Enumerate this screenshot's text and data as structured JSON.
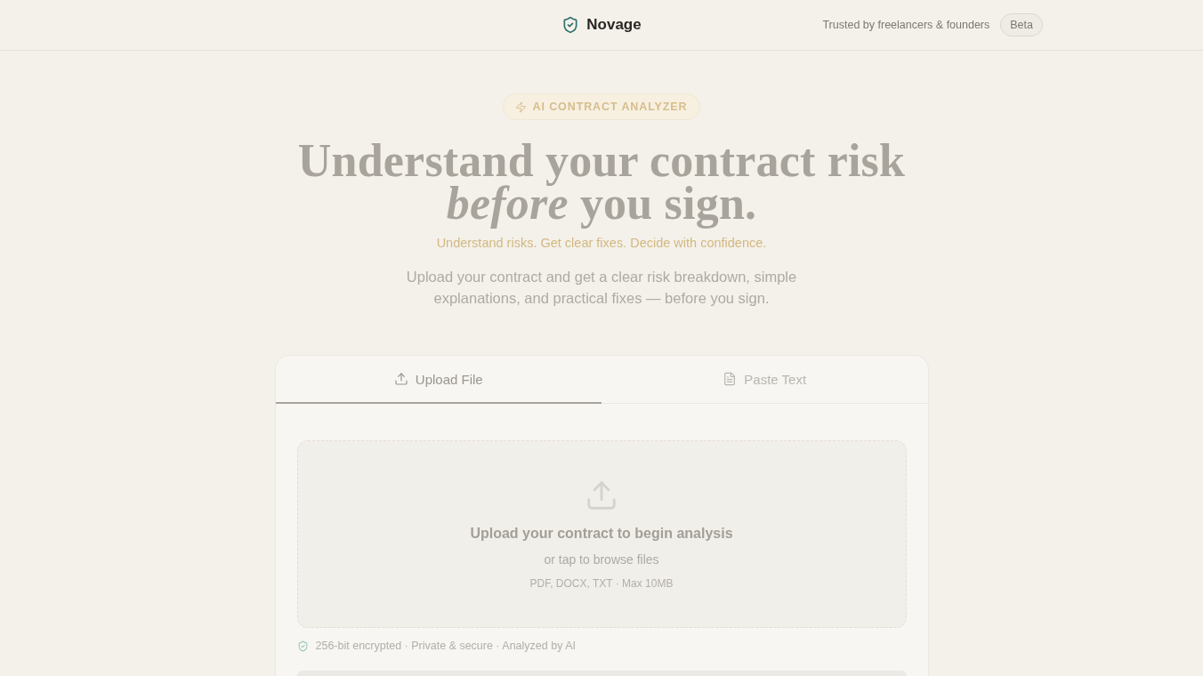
{
  "header": {
    "brand": "Novage",
    "tagline": "Trusted by freelancers & founders",
    "badge": "Beta"
  },
  "hero": {
    "eyebrow": "AI CONTRACT ANALYZER",
    "title_lines": [
      "Understand your contract risk",
      "*before* you sign."
    ],
    "subtitle": "Understand risks. Get clear fixes. Decide with confidence.",
    "description": "Upload your contract and get a clear risk breakdown, simple explanations, and practical fixes — before you sign."
  },
  "analyzer": {
    "tabs": [
      {
        "label": "Upload File",
        "selected": true
      },
      {
        "label": "Paste Text",
        "selected": false
      }
    ],
    "dropzone": {
      "title": "Upload your contract to begin analysis",
      "hint": "or tap to browse files",
      "formats": "PDF, DOCX, TXT · Max 10MB"
    },
    "security_note": "256-bit encrypted · Private & secure · Analyzed by AI"
  }
}
